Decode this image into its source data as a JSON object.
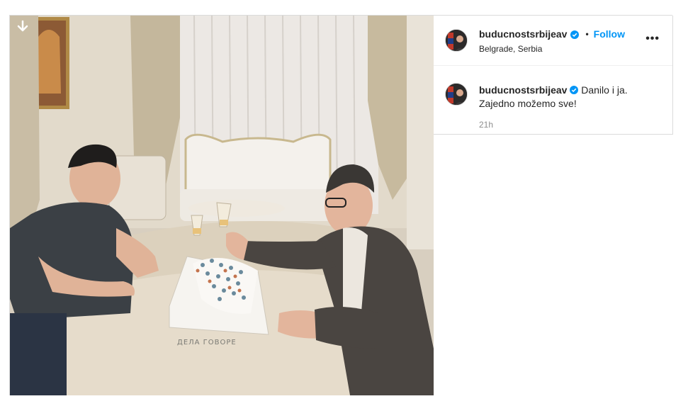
{
  "post": {
    "username": "buducnostsrbijeav",
    "follow_label": "Follow",
    "separator": "•",
    "location": "Belgrade, Serbia",
    "more_label": "•••",
    "caption_line1": "Danilo i ja.",
    "caption_line2": "Zajedno možemo sve!",
    "timestamp": "21h",
    "cake_text": "ДЕЛА ГОВОРЕ"
  },
  "icons": {
    "download": "download-arrow-icon",
    "verified": "verified-badge-icon",
    "more": "more-options-icon"
  },
  "colors": {
    "accent": "#0095f6",
    "text": "#262626",
    "muted": "#8e8e8e",
    "border": "#dbdbdb"
  }
}
